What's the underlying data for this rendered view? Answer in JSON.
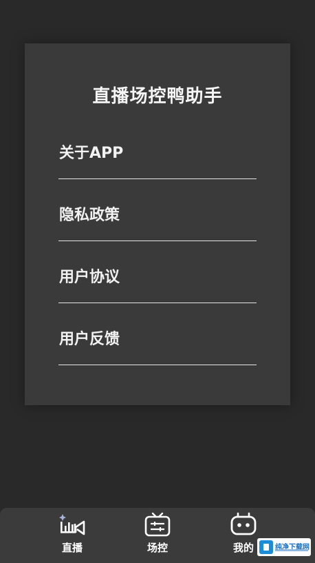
{
  "card": {
    "title": "直播场控鸭助手",
    "items": [
      {
        "label": "关于APP"
      },
      {
        "label": "隐私政策"
      },
      {
        "label": "用户协议"
      },
      {
        "label": "用户反馈"
      }
    ]
  },
  "tabbar": {
    "tabs": [
      {
        "label": "直播",
        "icon": "live-camera-icon"
      },
      {
        "label": "场控",
        "icon": "tv-control-icon"
      },
      {
        "label": "我的",
        "icon": "robot-profile-icon"
      }
    ]
  },
  "watermark": {
    "text": "纯净下载网"
  },
  "colors": {
    "background": "#292929",
    "card": "#3a3a3a",
    "tabbar": "#3b3b3b",
    "accent_star": "#a7b4d8"
  }
}
